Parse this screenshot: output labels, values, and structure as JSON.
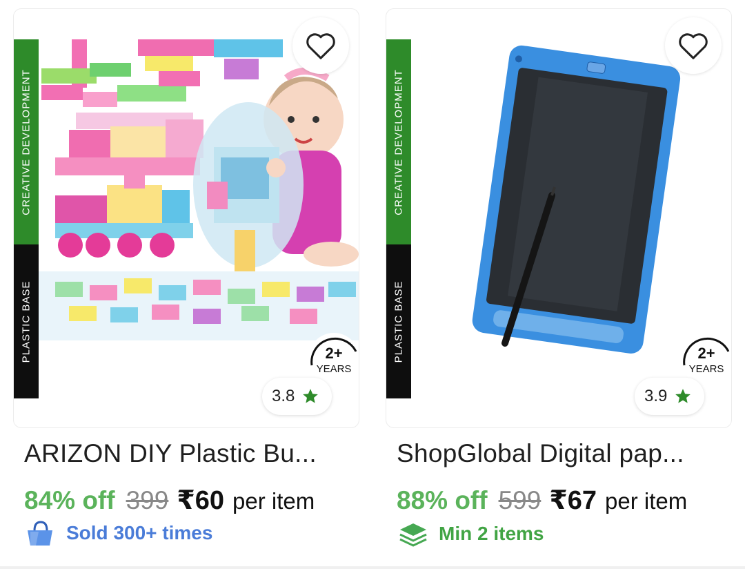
{
  "products": [
    {
      "side_top": "CREATIVE DEVELOPMENT",
      "side_bottom": "PLASTIC BASE",
      "age_top": "2+",
      "age_bottom": "YEARS",
      "rating": "3.8",
      "title": "ARIZON DIY Plastic Bu...",
      "discount": "84% off",
      "mrp": "399",
      "price": "₹60",
      "per": "per item",
      "tag": "Sold 300+ times",
      "tag_icon": "shopping-bag-icon"
    },
    {
      "side_top": "CREATIVE DEVELOPMENT",
      "side_bottom": "PLASTIC BASE",
      "age_top": "2+",
      "age_bottom": "YEARS",
      "rating": "3.9",
      "title": "ShopGlobal Digital pap...",
      "discount": "88% off",
      "mrp": "599",
      "price": "₹67",
      "per": "per item",
      "tag": "Min 2 items",
      "tag_icon": "layers-icon"
    }
  ],
  "colors": {
    "accent_green": "#5bb35b",
    "blue_tag": "#4a7cd8",
    "star": "#2e8b2a"
  }
}
